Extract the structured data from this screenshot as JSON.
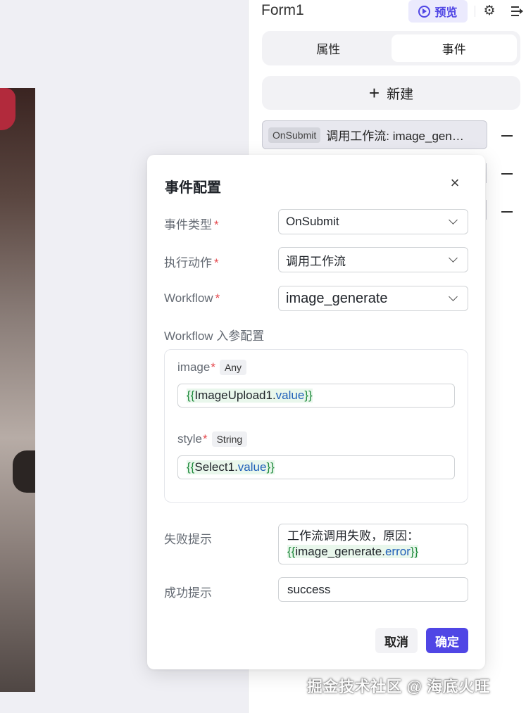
{
  "header": {
    "form_title": "Form1",
    "preview_label": "预览",
    "settings_icon": "gear-icon",
    "menu_icon": "collapse-menu-icon"
  },
  "tabs": [
    {
      "label": "属性",
      "active": false
    },
    {
      "label": "事件",
      "active": true
    }
  ],
  "new_button": {
    "plus": "+",
    "label": "新建"
  },
  "event_list": {
    "first": {
      "tag": "OnSubmit",
      "text": "调用工作流: image_gen…"
    }
  },
  "modal": {
    "title": "事件配置",
    "close_glyph": "×",
    "required_mark": "*",
    "event_type": {
      "label": "事件类型",
      "value": "OnSubmit"
    },
    "action": {
      "label": "执行动作",
      "value": "调用工作流"
    },
    "workflow": {
      "label": "Workflow",
      "value": "image_generate"
    },
    "params_title": "Workflow 入参配置",
    "params": [
      {
        "name": "image",
        "type": "Any",
        "open": "{{",
        "ref": "ImageUpload1",
        "dot": ".",
        "prop": "value",
        "close": "}}"
      },
      {
        "name": "style",
        "type": "String",
        "open": "{{",
        "ref": "Select1",
        "dot": ".",
        "prop": "value",
        "close": "}}"
      }
    ],
    "fail_tip": {
      "label": "失败提示",
      "line1": "工作流调用失败，原因：",
      "open": "{{",
      "ref": "image_generate",
      "dot": ".",
      "prop": "error",
      "close": "}}"
    },
    "success_tip": {
      "label": "成功提示",
      "value": "success"
    },
    "cancel_label": "取消",
    "ok_label": "确定"
  },
  "watermark": "掘金技术社区 @ 海底火旺",
  "colors": {
    "accent": "#5046e5",
    "required": "#e5484d",
    "token_green": "#1f8a3c",
    "token_blue": "#1f5fb8"
  }
}
